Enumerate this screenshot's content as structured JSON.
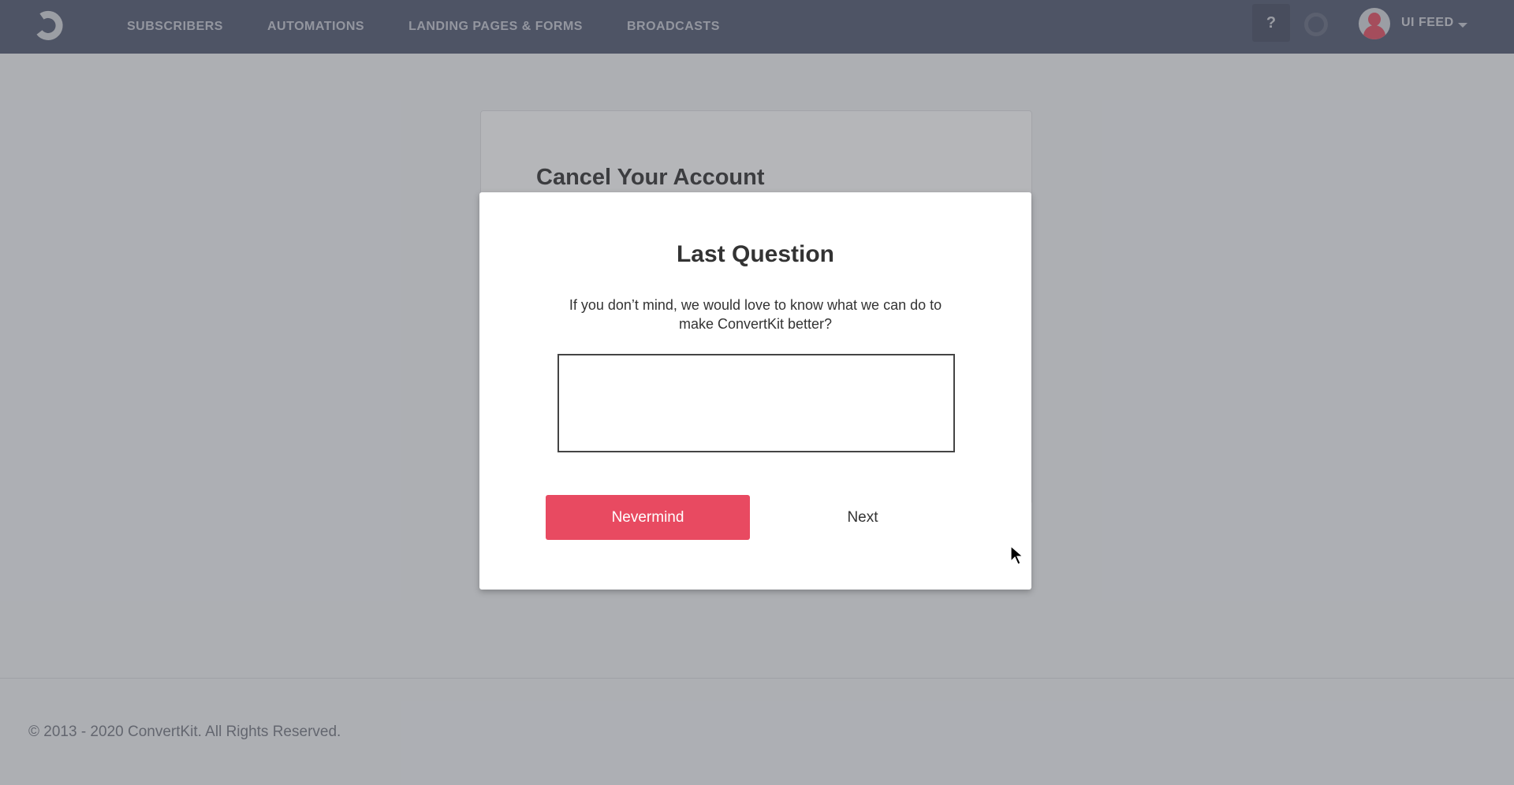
{
  "header": {
    "logo": "convertkit-logo",
    "nav": [
      {
        "label": "SUBSCRIBERS"
      },
      {
        "label": "AUTOMATIONS"
      },
      {
        "label": "LANDING PAGES & FORMS"
      },
      {
        "label": "BROADCASTS"
      }
    ],
    "help_label": "?",
    "user_name": "UI FEED",
    "brand_color": "#484d5f"
  },
  "page": {
    "title": "Cancel Your Account"
  },
  "modal": {
    "title": "Last Question",
    "description": "If you don’t mind, we would love to know what we can do to make ConvertKit better?",
    "feedback_value": "",
    "feedback_placeholder": "",
    "nevermind_label": "Nevermind",
    "next_label": "Next",
    "accent_color": "#e84a61"
  },
  "footer": {
    "copyright": "© 2013 - 2020 ConvertKit. All Rights Reserved."
  }
}
